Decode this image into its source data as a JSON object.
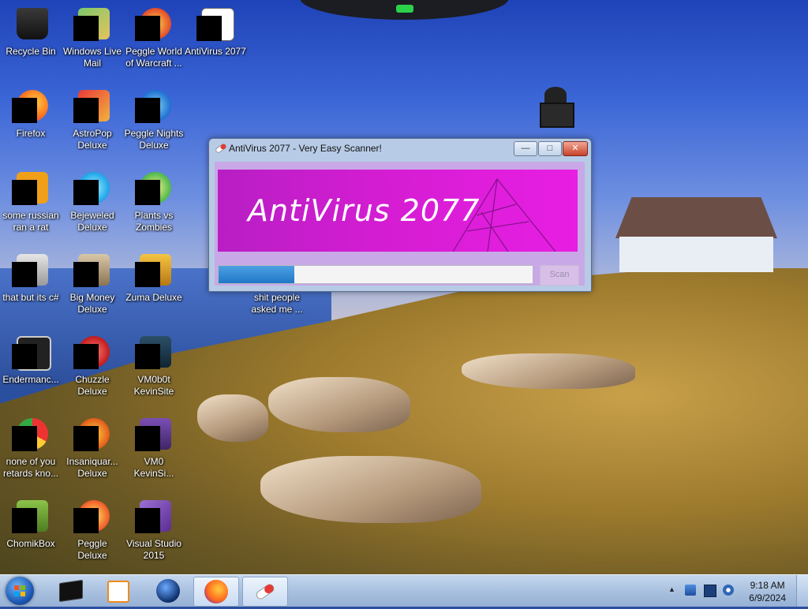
{
  "desktop": {
    "icons": [
      {
        "label": "Recycle Bin",
        "icon": "recycle-bin-icon"
      },
      {
        "label": "Windows Live Mail",
        "icon": "mail-icon"
      },
      {
        "label": "Peggle World of Warcraft ...",
        "icon": "peggle-icon"
      },
      {
        "label": "AntiVirus 2077",
        "icon": "msn-icon"
      },
      {
        "label": "Firefox",
        "icon": "firefox-icon"
      },
      {
        "label": "AstroPop Deluxe",
        "icon": "astropop-icon"
      },
      {
        "label": "Peggle Nights Deluxe",
        "icon": "peggle-nights-icon"
      },
      {
        "label": "some russian ran a rat",
        "icon": "file-icon"
      },
      {
        "label": "Bejeweled Deluxe",
        "icon": "bejeweled-icon"
      },
      {
        "label": "Plants vs Zombies",
        "icon": "plants-vs-zombies-icon"
      },
      {
        "label": "that but its c#",
        "icon": "folder-icon"
      },
      {
        "label": "Big Money Deluxe",
        "icon": "big-money-icon"
      },
      {
        "label": "Zuma Deluxe",
        "icon": "zuma-icon"
      },
      {
        "label": "shit people asked me ...",
        "icon": "text-file-icon"
      },
      {
        "label": "Endermanc...",
        "icon": "app-icon"
      },
      {
        "label": "Chuzzle Deluxe",
        "icon": "chuzzle-icon"
      },
      {
        "label": "VM0b0t KevinSite",
        "icon": "vm-icon"
      },
      {
        "label": "none of you retards kno...",
        "icon": "chrome-icon"
      },
      {
        "label": "Insaniquar... Deluxe",
        "icon": "insaniquarium-icon"
      },
      {
        "label": "VM0 KevinSi...",
        "icon": "vm-icon"
      },
      {
        "label": "ChomikBox",
        "icon": "chomikbox-icon"
      },
      {
        "label": "Peggle Deluxe",
        "icon": "peggle-icon"
      },
      {
        "label": "Visual Studio 2015",
        "icon": "visual-studio-icon"
      }
    ]
  },
  "window": {
    "title": "AntiVirus 2077 - Very Easy Scanner!",
    "minimize_label": "—",
    "maximize_label": "□",
    "close_label": "✕",
    "banner_title": "AntiVirus 2077",
    "progress": 0.24,
    "scan_label": "Scan"
  },
  "taskbar": {
    "items": [
      "start-orb",
      "terminal",
      "media-player",
      "globe",
      "firefox",
      "antivirus-2077"
    ],
    "time": "9:18 AM",
    "date": "6/9/2024",
    "tray_arrow": "▲"
  },
  "colors": {
    "banner": "#d41dd2",
    "progress": "#1f78c8",
    "window_frame": "#b7cbe6"
  }
}
